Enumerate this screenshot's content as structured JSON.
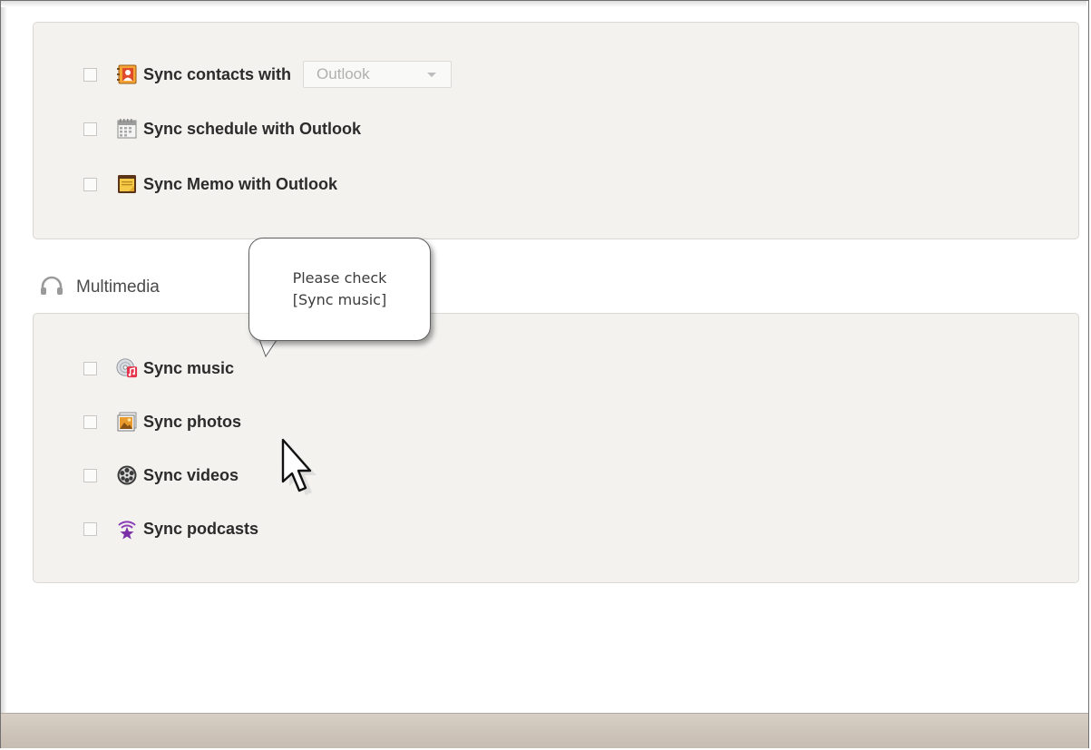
{
  "sync_section": {
    "items": [
      {
        "label": "Sync contacts with",
        "icon": "contacts-book-icon",
        "checked": false
      },
      {
        "label": "Sync schedule with Outlook",
        "icon": "calendar-icon",
        "checked": false
      },
      {
        "label": "Sync Memo with Outlook",
        "icon": "memo-icon",
        "checked": false
      }
    ],
    "contacts_dropdown": {
      "value": "Outlook"
    }
  },
  "multimedia": {
    "title": "Multimedia",
    "icon": "headphones-icon",
    "items": [
      {
        "label": "Sync music",
        "icon": "music-cd-icon",
        "checked": false
      },
      {
        "label": "Sync photos",
        "icon": "photos-icon",
        "checked": false
      },
      {
        "label": "Sync videos",
        "icon": "film-reel-icon",
        "checked": false
      },
      {
        "label": "Sync podcasts",
        "icon": "podcast-icon",
        "checked": false
      }
    ]
  },
  "callout": {
    "line1": "Please check",
    "line2": "[Sync music]"
  },
  "colors": {
    "panel_background": "#f3f2ef",
    "status_bar": "#cbc2b7",
    "label_text": "#2b2b2b"
  }
}
